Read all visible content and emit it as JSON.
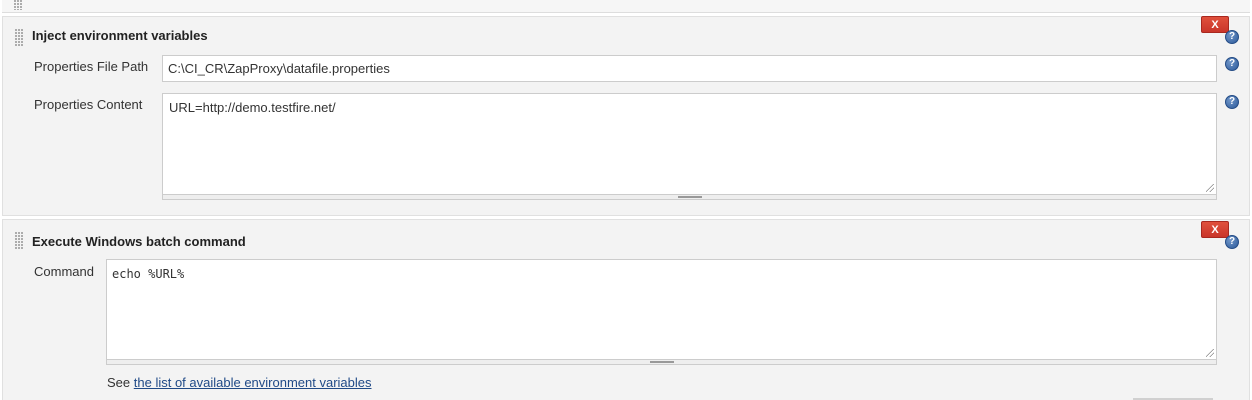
{
  "inject_env": {
    "title": "Inject environment variables",
    "delete_label": "X",
    "help_glyph": "?",
    "properties_file_path": {
      "label": "Properties File Path",
      "value": "C:\\CI_CR\\ZapProxy\\datafile.properties"
    },
    "properties_content": {
      "label": "Properties Content",
      "value": "URL=http://demo.testfire.net/"
    }
  },
  "batch_command": {
    "title": "Execute Windows batch command",
    "delete_label": "X",
    "help_glyph": "?",
    "command": {
      "label": "Command",
      "value": "echo %URL%"
    },
    "see_prefix": "See",
    "env_vars_link": "the list of available environment variables"
  },
  "colors": {
    "delete_button": "#d9432f",
    "help_icon": "#2d5a9a",
    "link": "#204a87",
    "section_background": "#f3f3f3"
  },
  "icons": {
    "drag_handle": "drag-handle-icon",
    "help": "help-icon",
    "resize": "resize-handle-icon"
  }
}
